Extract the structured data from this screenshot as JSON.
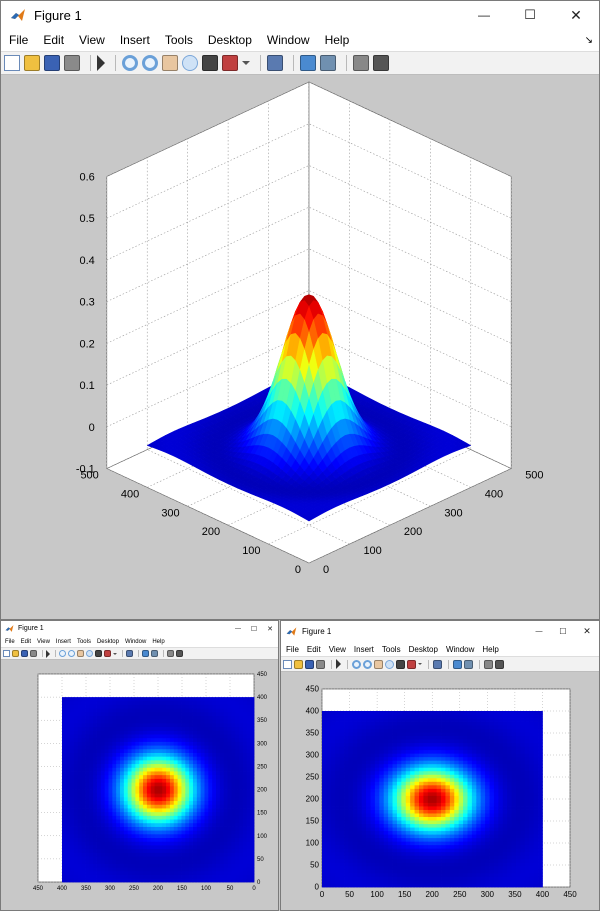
{
  "windows": {
    "main": {
      "title": "Figure 1",
      "menus": [
        "File",
        "Edit",
        "View",
        "Insert",
        "Tools",
        "Desktop",
        "Window",
        "Help"
      ],
      "controls": {
        "minimize": "—",
        "maximize": "☐",
        "close": "✕"
      },
      "dock_arrow": "↘"
    },
    "small_left": {
      "title": "Figure 1",
      "menus": [
        "File",
        "Edit",
        "View",
        "Insert",
        "Tools",
        "Desktop",
        "Window",
        "Help"
      ],
      "controls": {
        "minimize": "—",
        "maximize": "☐",
        "close": "✕"
      }
    },
    "small_right": {
      "title": "Figure 1",
      "menus": [
        "File",
        "Edit",
        "View",
        "Insert",
        "Tools",
        "Desktop",
        "Window",
        "Help"
      ],
      "controls": {
        "minimize": "—",
        "maximize": "☐",
        "close": "✕"
      }
    }
  },
  "toolbar_icons": [
    "new-figure-icon",
    "open-file-icon",
    "save-icon",
    "print-icon",
    "|",
    "pointer-icon",
    "|",
    "zoom-in-icon",
    "zoom-out-icon",
    "pan-hand-icon",
    "rotate-3d-icon",
    "data-cursor-icon",
    "brush-icon",
    "brush-dropdown-icon",
    "|",
    "link-plot-icon",
    "|",
    "colorbar-icon",
    "legend-icon",
    "|",
    "hide-tools-icon",
    "show-tools-icon"
  ],
  "colors": {
    "figure_bg": "#c8c8c8",
    "axes_bg": "#ffffff",
    "grid": "#bdbdbd",
    "jet_low": "#00008f",
    "jet_high": "#800000"
  },
  "chart_data": [
    {
      "type": "surface",
      "title": "",
      "xlabel": "",
      "ylabel": "",
      "zlabel": "",
      "x_ticks": [
        "0",
        "100",
        "200",
        "300",
        "400",
        "500"
      ],
      "y_ticks": [
        "0",
        "100",
        "200",
        "300",
        "400",
        "500"
      ],
      "z_ticks": [
        "-0.1",
        "0",
        "0.1",
        "0.2",
        "0.3",
        "0.4",
        "0.5",
        "0.6"
      ],
      "xlim": [
        0,
        500
      ],
      "ylim": [
        0,
        500
      ],
      "zlim": [
        -0.1,
        0.6
      ],
      "peak": {
        "x": 200,
        "y": 200,
        "z": 0.38
      },
      "colormap": "jet",
      "grid": true
    },
    {
      "type": "heatmap",
      "title": "",
      "x_ticks": [
        "450",
        "400",
        "350",
        "300",
        "250",
        "200",
        "150",
        "100",
        "50",
        "0"
      ],
      "y_ticks": [
        "0",
        "50",
        "100",
        "150",
        "200",
        "250",
        "300",
        "350",
        "400",
        "450"
      ],
      "xlim": [
        450,
        0
      ],
      "ylim": [
        0,
        450
      ],
      "data_extent": [
        0,
        400
      ],
      "center": {
        "x": 200,
        "y": 200
      },
      "colormap": "jet",
      "grid": true
    },
    {
      "type": "heatmap",
      "title": "",
      "x_ticks": [
        "0",
        "50",
        "100",
        "150",
        "200",
        "250",
        "300",
        "350",
        "400",
        "450"
      ],
      "y_ticks": [
        "0",
        "50",
        "100",
        "150",
        "200",
        "250",
        "300",
        "350",
        "400",
        "450"
      ],
      "xlim": [
        0,
        450
      ],
      "ylim": [
        0,
        450
      ],
      "data_extent": [
        0,
        400
      ],
      "center": {
        "x": 200,
        "y": 200
      },
      "colormap": "jet",
      "grid": true
    }
  ]
}
